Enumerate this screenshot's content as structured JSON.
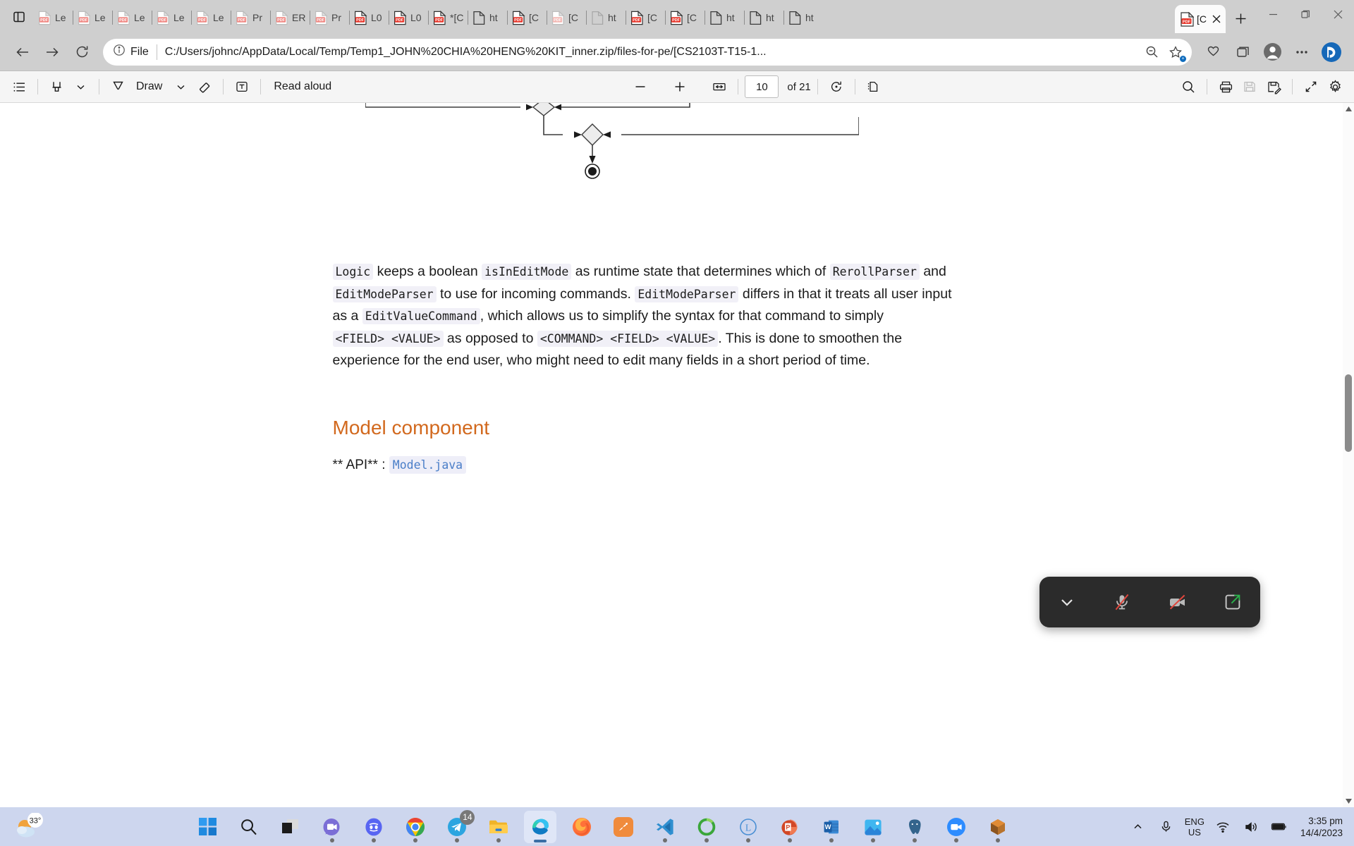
{
  "browser": {
    "tabs": [
      {
        "label": "Le",
        "icon": "pdf-icon",
        "state": "inactive"
      },
      {
        "label": "Le",
        "icon": "pdf-icon",
        "state": "inactive"
      },
      {
        "label": "Le",
        "icon": "pdf-icon",
        "state": "inactive"
      },
      {
        "label": "Le",
        "icon": "pdf-icon",
        "state": "inactive"
      },
      {
        "label": "Le",
        "icon": "pdf-icon",
        "state": "inactive"
      },
      {
        "label": "Pr",
        "icon": "pdf-icon",
        "state": "inactive"
      },
      {
        "label": "ER",
        "icon": "pdf-icon",
        "state": "inactive"
      },
      {
        "label": "Pr",
        "icon": "pdf-icon",
        "state": "inactive"
      },
      {
        "label": "L0",
        "icon": "pdf-icon-red",
        "state": "inactive"
      },
      {
        "label": "L0",
        "icon": "pdf-icon-red",
        "state": "inactive"
      },
      {
        "label": "*[C",
        "icon": "pdf-icon-red",
        "state": "inactive"
      },
      {
        "label": "ht",
        "icon": "page-icon",
        "state": "inactive"
      },
      {
        "label": "[C",
        "icon": "pdf-icon-red",
        "state": "inactive"
      },
      {
        "label": "[C",
        "icon": "pdf-icon-faded",
        "state": "inactive"
      },
      {
        "label": "ht",
        "icon": "page-icon-faded",
        "state": "inactive"
      },
      {
        "label": "[C",
        "icon": "pdf-icon-red",
        "state": "inactive"
      },
      {
        "label": "[C",
        "icon": "pdf-icon-red",
        "state": "inactive"
      },
      {
        "label": "ht",
        "icon": "page-icon",
        "state": "inactive"
      },
      {
        "label": "ht",
        "icon": "page-icon",
        "state": "inactive"
      },
      {
        "label": "ht",
        "icon": "page-icon",
        "state": "inactive"
      }
    ],
    "active_tab": {
      "label": "[CS",
      "icon": "pdf-icon-red"
    },
    "new_tab_label": "+",
    "window_controls": {
      "minimize": "minimize-icon",
      "maximize": "maximize-icon",
      "close": "close-icon"
    },
    "address": {
      "scheme_label": "File",
      "url": "C:/Users/johnc/AppData/Local/Temp/Temp1_JOHN%20CHIA%20HENG%20KIT_inner.zip/files-for-pe/[CS2103T-T15-1...",
      "info_icon": "info-circle-icon"
    },
    "nav": {
      "back": "back-arrow-icon",
      "forward": "forward-arrow-icon",
      "refresh": "refresh-icon"
    },
    "omni_buttons": [
      "zoom-out-icon",
      "favorite-star-icon"
    ],
    "toolbar_right": [
      "collections-icon",
      "browser-essentials-icon",
      "profile-icon",
      "settings-more-icon",
      "copilot-icon"
    ]
  },
  "pdf_toolbar": {
    "contents_label": "table-of-contents-icon",
    "highlight_label": "highlight-icon",
    "draw_label": "Draw",
    "erase_label": "erase-icon",
    "text_label": "add-text-icon",
    "read_aloud_label": "Read aloud",
    "zoom_out": "−",
    "zoom_in": "+",
    "fit_width": "fit-to-width-icon",
    "page_number": "10",
    "page_total": "of 21",
    "rotate": "rotate-icon",
    "page_view": "page-view-icon",
    "search": "search-icon",
    "print": "print-icon",
    "save": "save-icon",
    "save_as": "save-as-icon",
    "fullscreen": "fullscreen-icon",
    "settings": "settings-gear-icon"
  },
  "document": {
    "paragraph": {
      "c1": "Logic",
      "t1": " keeps a boolean ",
      "c2": "isInEditMode",
      "t2": " as runtime state that determines which of ",
      "c3": "RerollParser",
      "t3": " and ",
      "c4": "EditModeParser",
      "t4": " to use for incoming commands. ",
      "c5": "EditModeParser",
      "t5": " differs in that it treats all user input as a ",
      "c6": "EditValueCommand",
      "t6": ", which allows us to simplify the syntax for that command to simply ",
      "c7": "<FIELD> <VALUE>",
      "t7": " as opposed to ",
      "c8": "<COMMAND> <FIELD> <VALUE>",
      "t8": ". This is done to smoothen the experience for the end user, who might need to edit many fields in a short period of time."
    },
    "heading": "Model component",
    "api_prefix": "** API** :",
    "api_code": "Model.java",
    "diagram_name": "activity-diagram-merge-and-final-node"
  },
  "call_widget": {
    "collapse": "chevron-down-icon",
    "microphone": "microphone-muted-icon",
    "camera": "camera-muted-icon",
    "share": "share-screen-icon"
  },
  "taskbar": {
    "weather_temp": "33°",
    "apps": [
      {
        "name": "start-button",
        "label": "Start"
      },
      {
        "name": "search-taskbar",
        "label": "Search"
      },
      {
        "name": "task-view",
        "label": "Task View"
      },
      {
        "name": "microsoft-teams",
        "label": "Microsoft Teams",
        "running": true
      },
      {
        "name": "discord",
        "label": "Discord",
        "running": true
      },
      {
        "name": "google-chrome",
        "label": "Google Chrome",
        "running": true
      },
      {
        "name": "telegram",
        "label": "Telegram",
        "running": true,
        "badge": "14"
      },
      {
        "name": "file-explorer",
        "label": "File Explorer",
        "running": true
      },
      {
        "name": "microsoft-edge",
        "label": "Microsoft Edge",
        "active": true
      },
      {
        "name": "firefox",
        "label": "Firefox"
      },
      {
        "name": "sourcetree",
        "label": "Sourcetree"
      },
      {
        "name": "visual-studio-code",
        "label": "Visual Studio Code",
        "running": true
      },
      {
        "name": "mongodb-compass",
        "label": "MongoDB Compass",
        "running": true
      },
      {
        "name": "latex-editor",
        "label": "LaTeX Editor",
        "running": true
      },
      {
        "name": "microsoft-powerpoint",
        "label": "PowerPoint",
        "running": true
      },
      {
        "name": "microsoft-word",
        "label": "Word",
        "running": true
      },
      {
        "name": "photos",
        "label": "Photos",
        "running": true
      },
      {
        "name": "postgresql",
        "label": "PostgreSQL",
        "running": true
      },
      {
        "name": "zoom",
        "label": "zoom",
        "running": true
      },
      {
        "name": "blender",
        "label": "Blender",
        "running": true
      }
    ],
    "zoom_label": "zoom",
    "tray": {
      "show_hidden": "show-hidden-icons-chevron",
      "microphone": "microphone-icon",
      "language_line1": "ENG",
      "language_line2": "US",
      "wifi": "wifi-icon",
      "volume": "volume-icon",
      "battery": "battery-icon",
      "time": "3:35 pm",
      "date": "14/4/2023"
    }
  },
  "colors": {
    "heading": "#d2691e",
    "code_link": "#4a7ec8",
    "code_bg": "#f1f0f7",
    "taskbar_bg": "#cdd6ee",
    "chrome_bg": "#cfcfcf"
  }
}
